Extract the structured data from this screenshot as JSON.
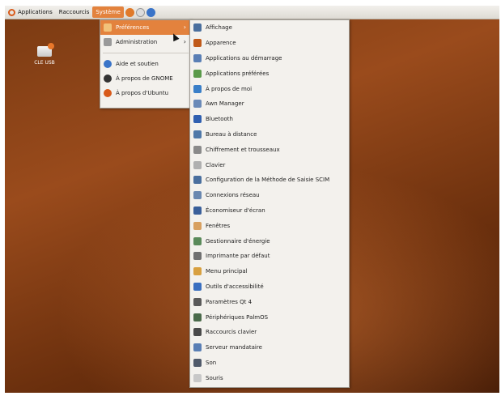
{
  "panel": {
    "applications": "Applications",
    "raccourcis": "Raccourcis",
    "systeme": "Système"
  },
  "desktop": {
    "usb_label": "CLE USB"
  },
  "system_menu": {
    "items": [
      {
        "label": "Préférences",
        "icon": "preferences-icon",
        "submenu": true
      },
      {
        "label": "Administration",
        "icon": "administration-icon",
        "submenu": true
      },
      {
        "label": "Aide et soutien",
        "icon": "help-icon"
      },
      {
        "label": "À propos de GNOME",
        "icon": "gnome-icon"
      },
      {
        "label": "À propos d'Ubuntu",
        "icon": "ubuntu-icon"
      }
    ]
  },
  "preferences_menu": {
    "items": [
      {
        "label": "Affichage",
        "icon": "display-icon",
        "color": "#4a6f9e"
      },
      {
        "label": "Apparence",
        "icon": "appearance-icon",
        "color": "#c05a1a"
      },
      {
        "label": "Applications au démarrage",
        "icon": "startup-icon",
        "color": "#5a7fb5"
      },
      {
        "label": "Applications préférées",
        "icon": "preferred-apps-icon",
        "color": "#5a9a4a"
      },
      {
        "label": "À propos de moi",
        "icon": "about-me-icon",
        "color": "#3a7fc8"
      },
      {
        "label": "Awn Manager",
        "icon": "awn-icon",
        "color": "#6a8ab8"
      },
      {
        "label": "Bluetooth",
        "icon": "bluetooth-icon",
        "color": "#2f5fb0"
      },
      {
        "label": "Bureau à distance",
        "icon": "remote-desktop-icon",
        "color": "#4f78a8"
      },
      {
        "label": "Chiffrement et trousseaux",
        "icon": "encryption-icon",
        "color": "#8a8a8a"
      },
      {
        "label": "Clavier",
        "icon": "keyboard-icon",
        "color": "#b0b0b0"
      },
      {
        "label": "Configuration de la Méthode de Saisie SCIM",
        "icon": "scim-icon",
        "color": "#4a6f9e"
      },
      {
        "label": "Connexions réseau",
        "icon": "network-icon",
        "color": "#6a88b0"
      },
      {
        "label": "Économiseur d'écran",
        "icon": "screensaver-icon",
        "color": "#3a5f9a"
      },
      {
        "label": "Fenêtres",
        "icon": "windows-icon",
        "color": "#d8a060"
      },
      {
        "label": "Gestionnaire d'énergie",
        "icon": "power-icon",
        "color": "#5a8a5a"
      },
      {
        "label": "Imprimante par défaut",
        "icon": "printer-icon",
        "color": "#707070"
      },
      {
        "label": "Menu principal",
        "icon": "main-menu-icon",
        "color": "#d8a040"
      },
      {
        "label": "Outils d'accessibilité",
        "icon": "accessibility-icon",
        "color": "#3a6fc0"
      },
      {
        "label": "Paramètres Qt 4",
        "icon": "qt-settings-icon",
        "color": "#5a5a5a"
      },
      {
        "label": "Périphériques PalmOS",
        "icon": "palmos-icon",
        "color": "#4a6a4a"
      },
      {
        "label": "Raccourcis clavier",
        "icon": "shortcuts-icon",
        "color": "#4a4a4a"
      },
      {
        "label": "Serveur mandataire",
        "icon": "proxy-icon",
        "color": "#5a7fb5"
      },
      {
        "label": "Son",
        "icon": "sound-icon",
        "color": "#505a6a"
      },
      {
        "label": "Souris",
        "icon": "mouse-icon",
        "color": "#c8c8c8"
      }
    ]
  }
}
